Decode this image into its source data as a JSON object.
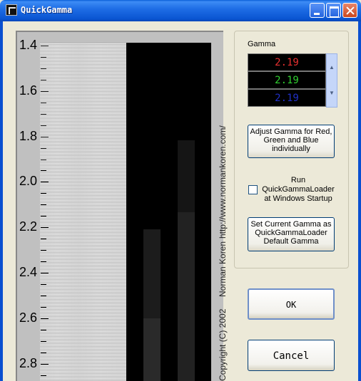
{
  "window": {
    "title": "QuickGamma"
  },
  "chart": {
    "scale_labels": [
      "1.4",
      "1.6",
      "1.8",
      "2.0",
      "2.2",
      "2.4",
      "2.6",
      "2.8"
    ],
    "credit_copyright": "Copyright (C) 2002",
    "credit_author": "Norman Koren",
    "credit_url": "http://www.normankoren.com/"
  },
  "gamma": {
    "label": "Gamma",
    "red_value": "2.19",
    "green_value": "2.19",
    "blue_value": "2.19",
    "colors": {
      "red": "#e83030",
      "green": "#30d030",
      "blue": "#2030c8"
    }
  },
  "buttons": {
    "adjust_rgb": [
      "Adjust Gamma for Red,",
      "Green and Blue",
      "individually"
    ],
    "set_default": [
      "Set Current Gamma as",
      "QuickGammaLoader",
      "Default Gamma"
    ],
    "ok": "OK",
    "cancel": "Cancel"
  },
  "startup": {
    "label": [
      "Run",
      "QuickGammaLoader",
      "at Windows Startup"
    ],
    "checked": false
  }
}
